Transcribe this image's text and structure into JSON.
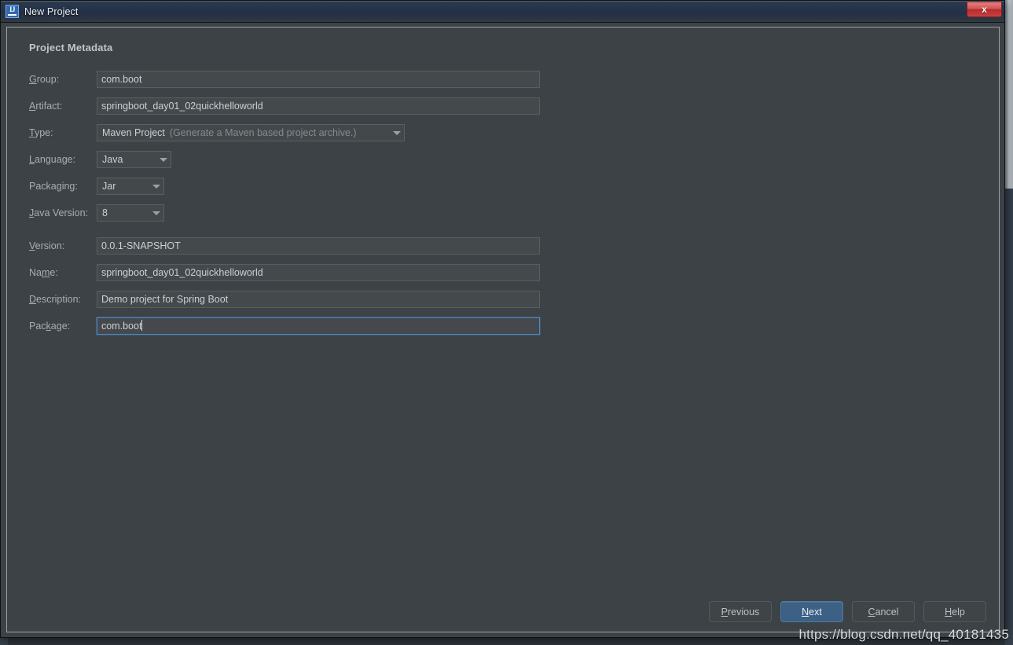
{
  "window": {
    "title": "New Project",
    "icon": "intellij-idea-icon",
    "close_label": "x"
  },
  "section": {
    "title": "Project Metadata"
  },
  "form": {
    "group": {
      "label_pre": "",
      "label_mn": "G",
      "label_post": "roup:",
      "value": "com.boot"
    },
    "artifact": {
      "label_pre": "",
      "label_mn": "A",
      "label_post": "rtifact:",
      "value": "springboot_day01_02quickhelloworld"
    },
    "type": {
      "label_pre": "",
      "label_mn": "T",
      "label_post": "ype:",
      "value": "Maven Project",
      "hint": "(Generate a Maven based project archive.)"
    },
    "language": {
      "label_pre": "",
      "label_mn": "L",
      "label_post": "anguage:",
      "value": "Java"
    },
    "packaging": {
      "label_pre": "Packa",
      "label_mn": "g",
      "label_post": "ing:",
      "value": "Jar"
    },
    "java_version": {
      "label_pre": "",
      "label_mn": "J",
      "label_post": "ava Version:",
      "value": "8"
    },
    "version": {
      "label_pre": "",
      "label_mn": "V",
      "label_post": "ersion:",
      "value": "0.0.1-SNAPSHOT"
    },
    "name": {
      "label_pre": "Na",
      "label_mn": "m",
      "label_post": "e:",
      "value": "springboot_day01_02quickhelloworld"
    },
    "description": {
      "label_pre": "",
      "label_mn": "D",
      "label_post": "escription:",
      "value": "Demo project for Spring Boot"
    },
    "package": {
      "label_pre": "Pac",
      "label_mn": "k",
      "label_post": "age:",
      "value": "com.boot"
    }
  },
  "footer": {
    "previous": {
      "pre": "",
      "mn": "P",
      "post": "revious"
    },
    "next": {
      "pre": "",
      "mn": "N",
      "post": "ext"
    },
    "cancel": {
      "pre": "",
      "mn": "C",
      "post": "ancel"
    },
    "help": {
      "pre": "",
      "mn": "H",
      "post": "elp"
    }
  },
  "watermark": {
    "text": "https://blog.csdn.net/qq_40181435"
  },
  "colors": {
    "dialog_bg": "#3c4245",
    "field_bg": "#44494c",
    "focus_border": "#4a88c7",
    "default_button": "#3d6185",
    "titlebar": "#26344a"
  }
}
